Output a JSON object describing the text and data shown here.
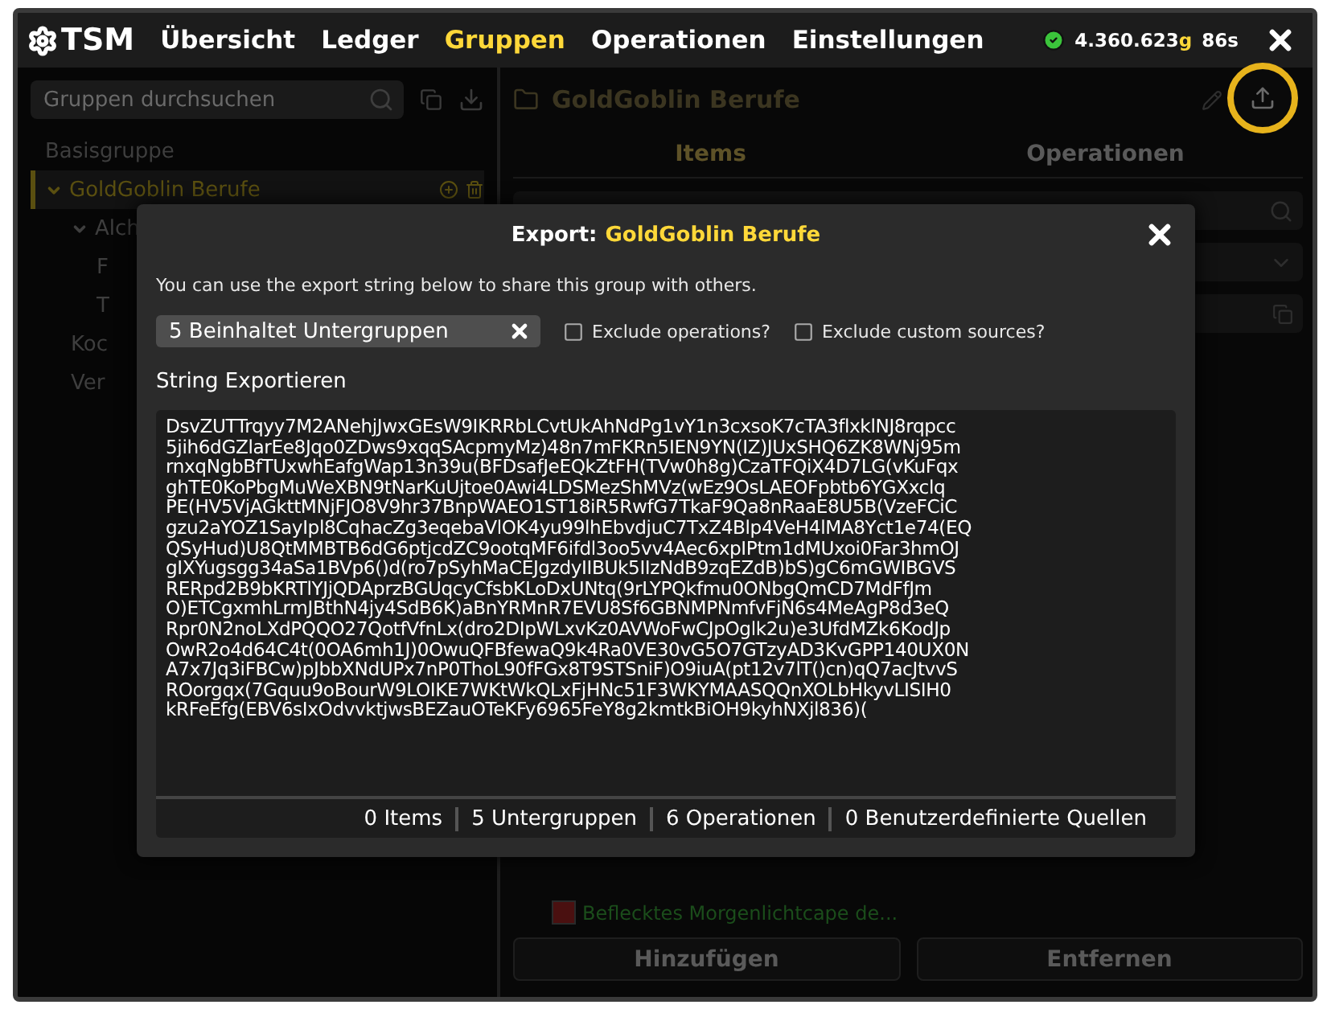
{
  "top_bar": {
    "logo": "TSM",
    "nav": [
      {
        "label": "Übersicht",
        "selected": false
      },
      {
        "label": "Ledger",
        "selected": false
      },
      {
        "label": "Gruppen",
        "selected": true
      },
      {
        "label": "Operationen",
        "selected": false
      },
      {
        "label": "Einstellungen",
        "selected": false
      }
    ],
    "gold": {
      "amount": "4.360.623",
      "unit": "g",
      "timer": "86s"
    }
  },
  "groups_panel": {
    "search": {
      "placeholder": "Gruppen durchsuchen"
    },
    "tree": [
      {
        "label": "Basisgruppe",
        "selected": false,
        "expanded": false
      },
      {
        "label": "GoldGoblin Berufe",
        "selected": true,
        "expanded": true,
        "children": [
          {
            "label": "Alch",
            "selected": false,
            "expanded": true,
            "children": [
              {
                "label": "F",
                "selected": false,
                "expanded": false
              },
              {
                "label": "T",
                "selected": false,
                "expanded": false
              }
            ]
          },
          {
            "label": "Koc",
            "selected": false,
            "expanded": false
          },
          {
            "label": "Ver",
            "selected": false,
            "expanded": false
          }
        ]
      }
    ]
  },
  "group_panel": {
    "title": "GoldGoblin Berufe",
    "tabs": [
      {
        "label": "Items",
        "selected": true
      },
      {
        "label": "Operationen",
        "selected": false
      }
    ],
    "items": [
      "Beflecktes Morgenlichtcape de..."
    ],
    "buttons": [
      "Hinzufügen",
      "Entfernen"
    ]
  },
  "export_dialog": {
    "title": "Export:",
    "group_name": "GoldGoblin Berufe",
    "description": "You can use the export string below to share this group with others.",
    "filter_tag": "5 Beinhaltet Untergruppen",
    "options": [
      {
        "label": "Exclude operations?",
        "checked": false
      },
      {
        "label": "Exclude custom sources?",
        "checked": false
      }
    ],
    "string_label": "String Exportieren",
    "export_string": [
      "DsvZUTTrqyy7M2ANehjJwxGEsW9IKRRbLCvtUkAhNdPg1vY1n3cxsoK7cTA3flxklNJ8rqpcc",
      "5jih6dGZlarEe8Jqo0ZDws9xqqSAcpmyMz)48n7mFKRn5IEN9YN(IZ)JUxSHQ6ZK8WNj95m",
      "rnxqNgbBfTUxwhEafgWap13n39u(BFDsafJeEQkZtFH(TVw0h8g)CzaTFQiX4D7LG(vKuFqx",
      "ghTE0KoPbgMuWeXBN9tNarKuUjtoe0Awi4LDSMezShMVz(wEz9OsLAEOFpbtb6YGXxclq",
      "PE(HV5VjAGkttMNjFJO8V9hr37BnpWAEO1ST18iR5RwfG7TkaF9Qa8nRaaE8U5B(VzeFCiC",
      "gzu2aYOZ1SayIpl8CqhacZg3eqebaVlOK4yu99lhEbvdjuC7TxZ4Blp4VeH4lMA8Yct1e74(EQ",
      "QSyHud)U8QtMMBTB6dG6ptjcdZC9ootqMF6ifdl3oo5vv4Aec6xpIPtm1dMUxoi0Far3hmOJ",
      "gIXYugsgg34aSa1BVp6()d(ro7pSyhMaCEJgzdyIIBUk5IIzNdB9zqEZdB)bS)gC6mGWIBGVS",
      "RERpd2B9bKRTlYJjQDAprzBGUqcyCfsbKLoDxUNtq(9rLYPQkfmu0ONbgQmCD7MdFfJm",
      "O)ETCgxmhLrmJBthN4jy4SdB6K)aBnYRMnR7EVU8Sf6GBNMPNmfvFjN6s4MeAgP8d3eQ",
      "Rpr0N2noLXdPQQO27QotfVfnLx(dro2DIpWLxvKz0AVWoFwCJpOglk2u)e3UfdMZk6KodJp",
      "OwR2o4d64C4t(0OA6mh1J)0OwuQFBfewaQ9k4Ra0VE30vG5O7GTzyAD3KvGPP140UX0N",
      "A7x7Jq3iFBCw)pJbbXNdUPx7nP0ThoL90fFGx8T9STSniF)O9iuA(pt12v7lT()cn)qQ7acJtvvS",
      "ROorgqx(7Gquu9oBourW9LOIKE7WKtWkQLxFjHNc51F3WKYMAASQQnXOLbHkyvLISIH0",
      "kRFeEfg(EBV6sIxOdvvktjwsBEZauOTeKFy6965FeY8g2kmtkBiOH9kyhNXjl836)("
    ],
    "stats": [
      "0 Items",
      "5 Untergruppen",
      "6 Operationen",
      "0 Benutzerdefinierte Quellen"
    ]
  }
}
